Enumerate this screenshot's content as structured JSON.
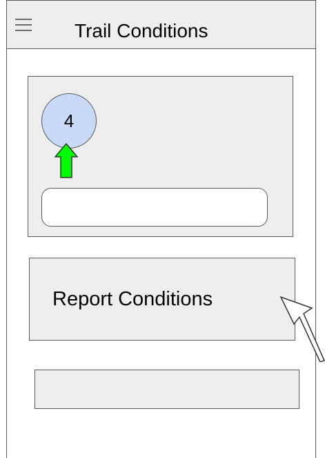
{
  "header": {
    "title": "Trail Conditions",
    "menu_icon": "hamburger-menu-icon"
  },
  "card": {
    "count": "4",
    "upvote_icon": "up-arrow-icon",
    "upvote_color": "#00ff00",
    "badge_color": "#c9daf8",
    "input_value": ""
  },
  "report_button": {
    "label": "Report Conditions"
  },
  "pointer": {
    "icon": "mouse-cursor-icon"
  },
  "colors": {
    "panel_fill": "#eeeeee",
    "outline": "#595959"
  }
}
